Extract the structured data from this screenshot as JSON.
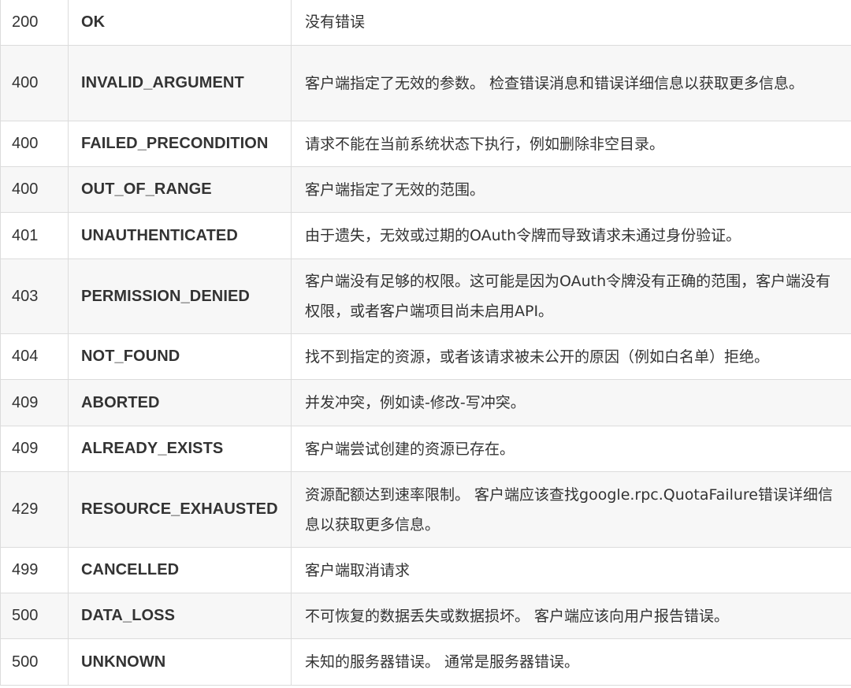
{
  "rows": [
    {
      "code": "200",
      "name": "OK",
      "desc": "没有错误"
    },
    {
      "code": "400",
      "name": "INVALID_ARGUMENT",
      "desc": "客户端指定了无效的参数。 检查错误消息和错误详细信息以获取更多信息。"
    },
    {
      "code": "400",
      "name": "FAILED_PRECONDITION",
      "desc": "请求不能在当前系统状态下执行，例如删除非空目录。"
    },
    {
      "code": "400",
      "name": "OUT_OF_RANGE",
      "desc": "客户端指定了无效的范围。"
    },
    {
      "code": "401",
      "name": "UNAUTHENTICATED",
      "desc": "由于遗失，无效或过期的OAuth令牌而导致请求未通过身份验证。"
    },
    {
      "code": "403",
      "name": "PERMISSION_DENIED",
      "desc": "客户端没有足够的权限。这可能是因为OAuth令牌没有正确的范围，客户端没有权限，或者客户端项目尚未启用API。"
    },
    {
      "code": "404",
      "name": "NOT_FOUND",
      "desc": "找不到指定的资源，或者该请求被未公开的原因（例如白名单）拒绝。"
    },
    {
      "code": "409",
      "name": "ABORTED",
      "desc": "并发冲突，例如读-修改-写冲突。"
    },
    {
      "code": "409",
      "name": "ALREADY_EXISTS",
      "desc": "客户端尝试创建的资源已存在。"
    },
    {
      "code": "429",
      "name": "RESOURCE_EXHAUSTED",
      "desc": "资源配额达到速率限制。 客户端应该查找google.rpc.QuotaFailure错误详细信息以获取更多信息。"
    },
    {
      "code": "499",
      "name": "CANCELLED",
      "desc": "客户端取消请求"
    },
    {
      "code": "500",
      "name": "DATA_LOSS",
      "desc": "不可恢复的数据丢失或数据损坏。 客户端应该向用户报告错误。"
    },
    {
      "code": "500",
      "name": "UNKNOWN",
      "desc": "未知的服务器错误。 通常是服务器错误。"
    }
  ]
}
